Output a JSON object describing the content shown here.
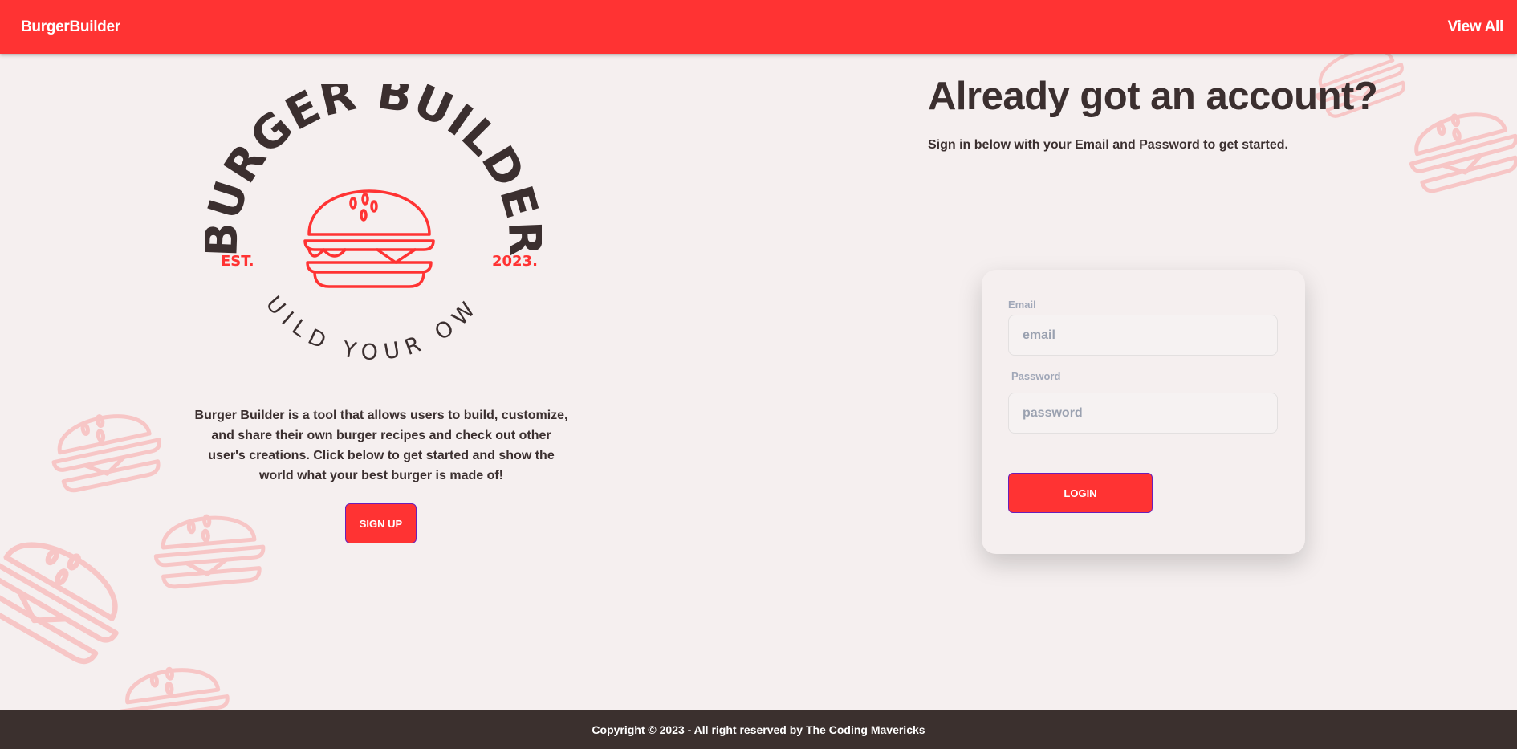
{
  "navbar": {
    "brand": "BurgerBuilder",
    "view_all": "View All"
  },
  "logo": {
    "title_text": "BURGER BUILDER",
    "est": "EST.",
    "year": "2023.",
    "tagline": "BUILD YOUR OWN"
  },
  "intro": {
    "description": "Burger Builder is a tool that allows users to build, customize, and share their own burger recipes and check out other user's creations. Click below to get started and show the world what your best burger is made of!",
    "signup_label": "SIGN UP"
  },
  "login": {
    "heading": "Already got an account?",
    "subheading": "Sign in below with your Email and Password to get started.",
    "email_label": "Email",
    "email_placeholder": "email",
    "password_label": "Password",
    "password_placeholder": "password",
    "login_label": "LOGIN"
  },
  "footer": {
    "copyright": "Copyright © 2023 - All right reserved by The Coding Mavericks"
  },
  "colors": {
    "accent": "#ff3333",
    "dark": "#3b2f2f",
    "background": "#f5efef",
    "footer": "#3b302e"
  },
  "icons": {
    "logo_icon": "burger-icon",
    "background_icon": "burger-icon"
  }
}
